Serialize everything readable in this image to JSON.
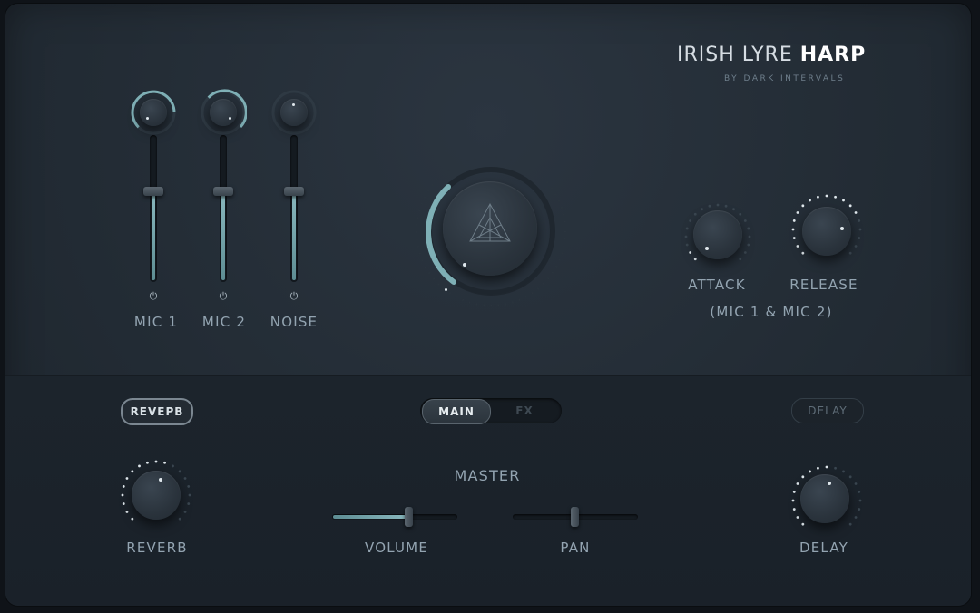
{
  "header": {
    "title_light": "IRISH LYRE",
    "title_bold": "HARP",
    "subtitle": "BY DARK INTERVALS"
  },
  "mixer": {
    "channels": [
      {
        "label": "MIC 1",
        "level": 0.6,
        "pan": 0.75
      },
      {
        "label": "MIC 2",
        "level": 0.6,
        "pan": 0.8
      },
      {
        "label": "NOISE",
        "level": 0.6,
        "pan": 0.5
      }
    ]
  },
  "main_knob": {
    "icon": "triangle-logo-icon",
    "value": 0.3
  },
  "envelope": {
    "attack_label": "ATTACK",
    "release_label": "RELEASE",
    "scope_label": "(MIC 1 & MIC 2)",
    "attack_value": 0.1,
    "release_value": 0.75
  },
  "tabs": {
    "main_label": "MAIN",
    "fx_label": "FX",
    "active": "MAIN"
  },
  "reverb": {
    "toggle_label": "REVEРB",
    "knob_label": "REVERB",
    "value": 0.6
  },
  "delay": {
    "toggle_label": "DELAY",
    "knob_label": "DELAY",
    "value": 0.55
  },
  "master": {
    "label": "MASTER",
    "volume_label": "VOLUME",
    "volume_value": 0.6,
    "pan_label": "PAN",
    "pan_value": 0.5
  },
  "colors": {
    "accent": "#7fb0b6",
    "background": "#232c35",
    "text": "#93a4b1"
  }
}
